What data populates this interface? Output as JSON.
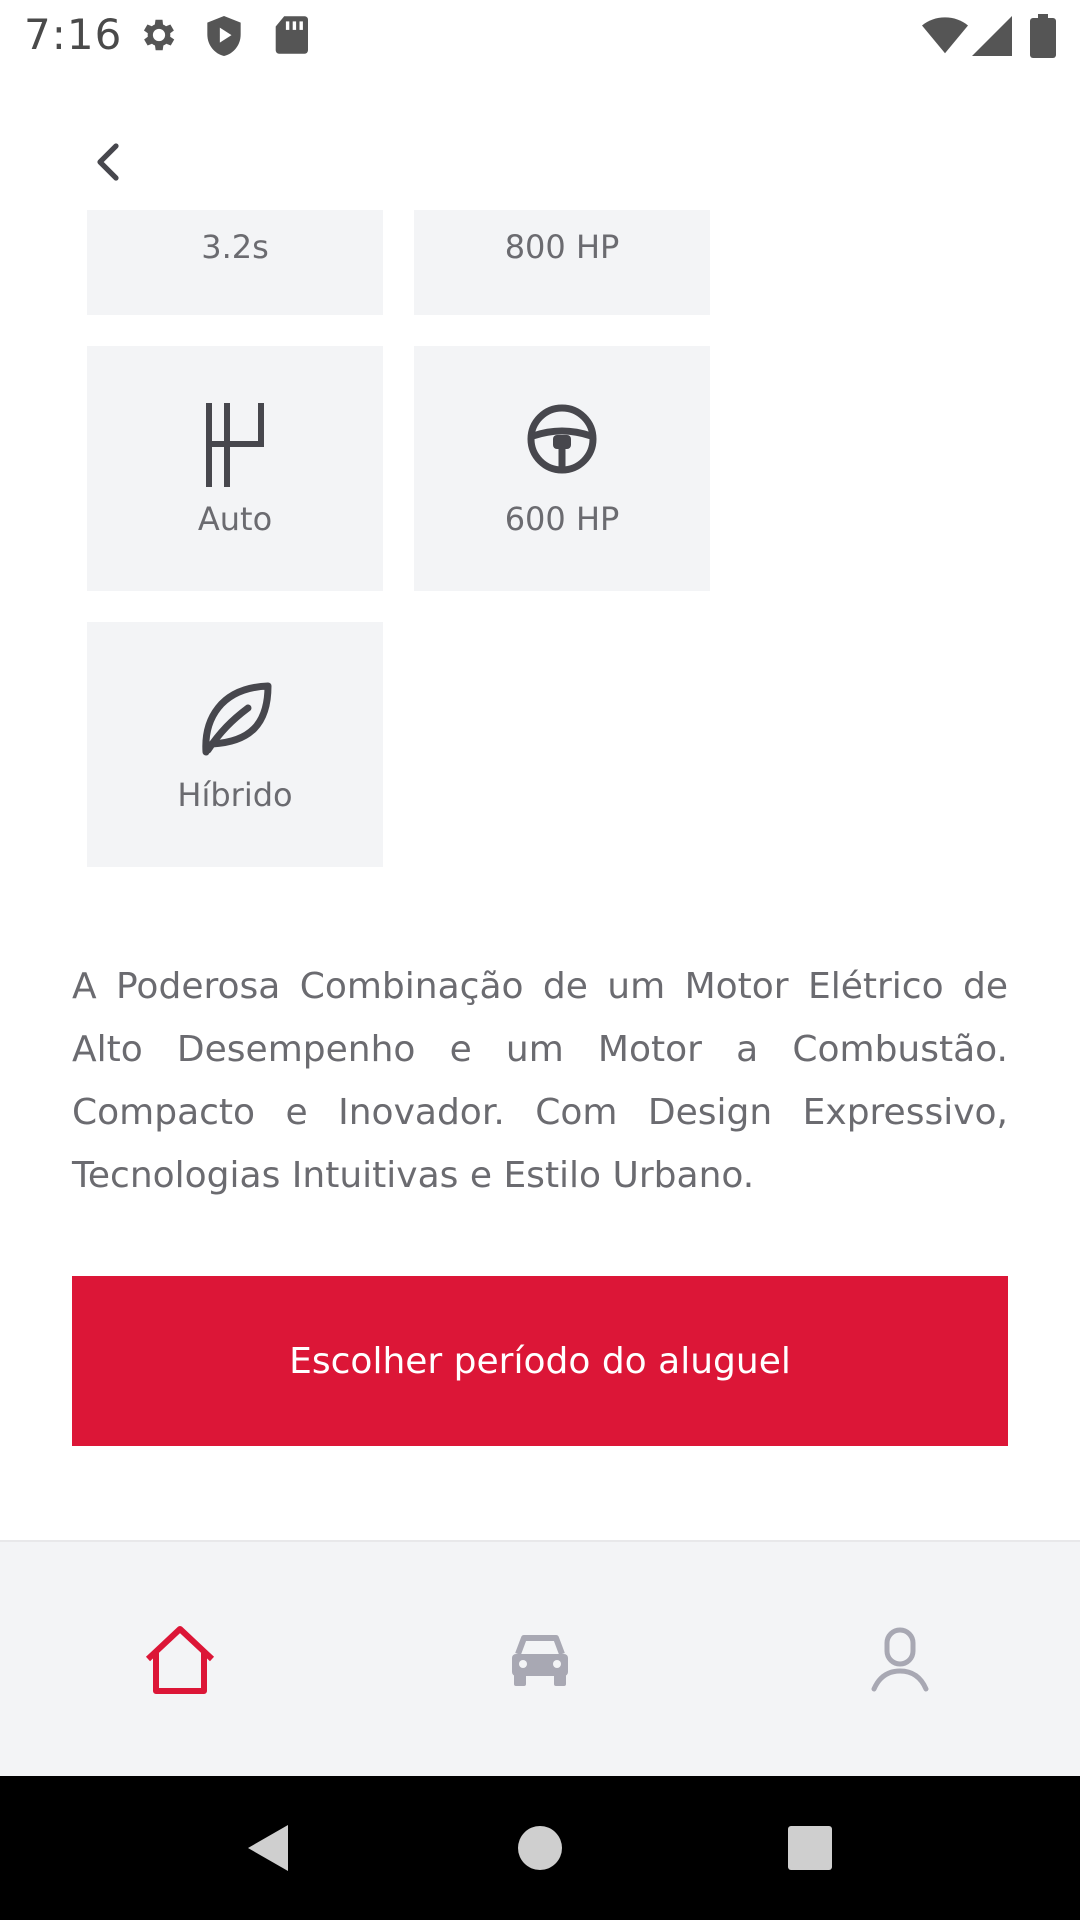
{
  "status_bar": {
    "time": "7:16",
    "icons_left": [
      "settings-icon",
      "shield-play-icon",
      "sd-card-icon"
    ],
    "icons_right": [
      "wifi-icon",
      "cell-signal-icon",
      "battery-icon"
    ]
  },
  "header": {
    "back_icon": "chevron-left-icon"
  },
  "specs": [
    {
      "label": "3.2s",
      "icon": "speed-icon"
    },
    {
      "label": "800 HP",
      "icon": "power-icon"
    },
    {
      "label": "Auto",
      "icon": "gearshift-icon"
    },
    {
      "label": "600 HP",
      "icon": "steering-wheel-icon"
    },
    {
      "label": "Híbrido",
      "icon": "leaf-icon"
    }
  ],
  "description": "A Poderosa Combinação de um Motor Elétrico de Alto Desempenho e um Motor a Combustão. Compacto e Inovador. Com Design Expressivo, Tecnologias Intuitivas e Estilo Urbano.",
  "cta": {
    "label": "Escolher período do aluguel"
  },
  "bottom_nav": {
    "items": [
      {
        "icon": "home-icon",
        "active": true
      },
      {
        "icon": "car-icon",
        "active": false
      },
      {
        "icon": "profile-icon",
        "active": false
      }
    ],
    "active_color": "#DC1637",
    "inactive_color": "#A8A8B3"
  },
  "colors": {
    "accent": "#DC1637",
    "card_bg": "#F3F4F6",
    "text": "#6B6B70",
    "icon": "#47474D"
  }
}
